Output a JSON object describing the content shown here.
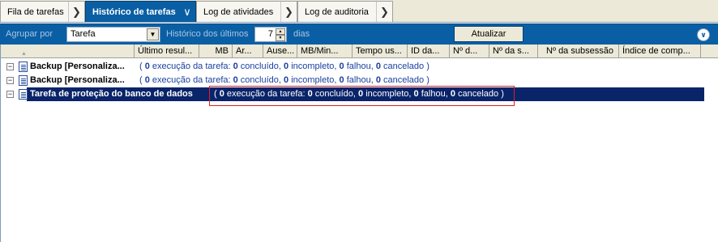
{
  "tabs": [
    {
      "label": "Fila de tarefas",
      "active": false
    },
    {
      "label": "Histórico de tarefas",
      "active": true
    },
    {
      "label": "Log de atividades",
      "active": false
    },
    {
      "label": "Log de auditoria",
      "active": false
    }
  ],
  "toolbar": {
    "group_by_label": "Agrupar por",
    "group_by_value": "Tarefa",
    "history_label": "Histórico dos últimos",
    "days_value": "7",
    "days_unit": "dias",
    "update_button": "Atualizar"
  },
  "columns": [
    "Último resul...",
    "MB",
    "Ar...",
    "Ause...",
    "MB/Min...",
    "Tempo us...",
    "ID da...",
    "Nº d...",
    "Nº da s...",
    "Nº da subsessão",
    "Índice de comp..."
  ],
  "rows": [
    {
      "name": "Backup [Personaliza...",
      "exec": "0",
      "exec_label": "execução da tarefa:",
      "done": "0",
      "done_label": "concluído,",
      "incomplete": "0",
      "incomplete_label": "incompleto,",
      "failed": "0",
      "failed_label": "falhou,",
      "canceled": "0",
      "canceled_label": "cancelado )"
    },
    {
      "name": "Backup [Personaliza...",
      "exec": "0",
      "exec_label": "execução da tarefa:",
      "done": "0",
      "done_label": "concluído,",
      "incomplete": "0",
      "incomplete_label": "incompleto,",
      "failed": "0",
      "failed_label": "falhou,",
      "canceled": "0",
      "canceled_label": "cancelado )"
    },
    {
      "name": "Tarefa de proteção do banco de dados",
      "exec": "0",
      "exec_label": "execução da tarefa:",
      "done": "0",
      "done_label": "concluído,",
      "incomplete": "0",
      "incomplete_label": "incompleto,",
      "failed": "0",
      "failed_label": "falhou,",
      "canceled": "0",
      "canceled_label": "cancelado )"
    }
  ],
  "colors": {
    "accent": "#0a5fa4",
    "selection": "#0a246a",
    "highlight": "#e02020"
  },
  "icons": [
    "chevron-right-icon",
    "chevron-down-icon",
    "collapse-double-chevron-icon",
    "document-icon",
    "collapse-minus-icon"
  ]
}
